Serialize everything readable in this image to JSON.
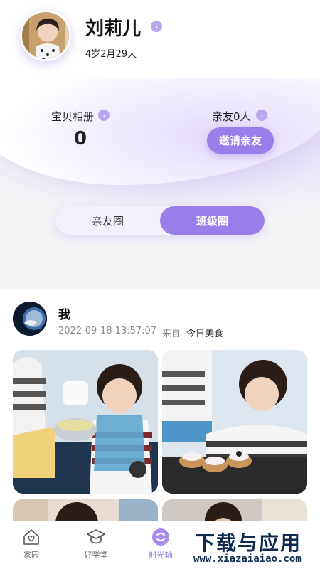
{
  "profile": {
    "name": "刘莉儿",
    "age": "4岁2月29天"
  },
  "stats": {
    "album_label": "宝贝相册",
    "album_count": "0",
    "friends_label": "亲友0人",
    "invite_label": "邀请亲友"
  },
  "segments": {
    "friends_circle": "亲友圈",
    "class_circle": "班级圈",
    "active": "班级圈"
  },
  "post": {
    "author": "我",
    "timestamp": "2022-09-18 13:57:07",
    "from_label": "来自",
    "source": "今日美食"
  },
  "tabs": [
    {
      "label": "家园",
      "icon": "house-heart-icon"
    },
    {
      "label": "好学堂",
      "icon": "graduation-cap-icon"
    },
    {
      "label": "时光轴",
      "icon": "timeline-icon",
      "active": true
    }
  ],
  "watermark": {
    "title": "下载与应用",
    "url": "www.xiazaiaiao.com"
  },
  "colors": {
    "accent": "#9a7ee9",
    "accent_light": "#b9a6f0",
    "watermark": "#0e2a4f"
  }
}
